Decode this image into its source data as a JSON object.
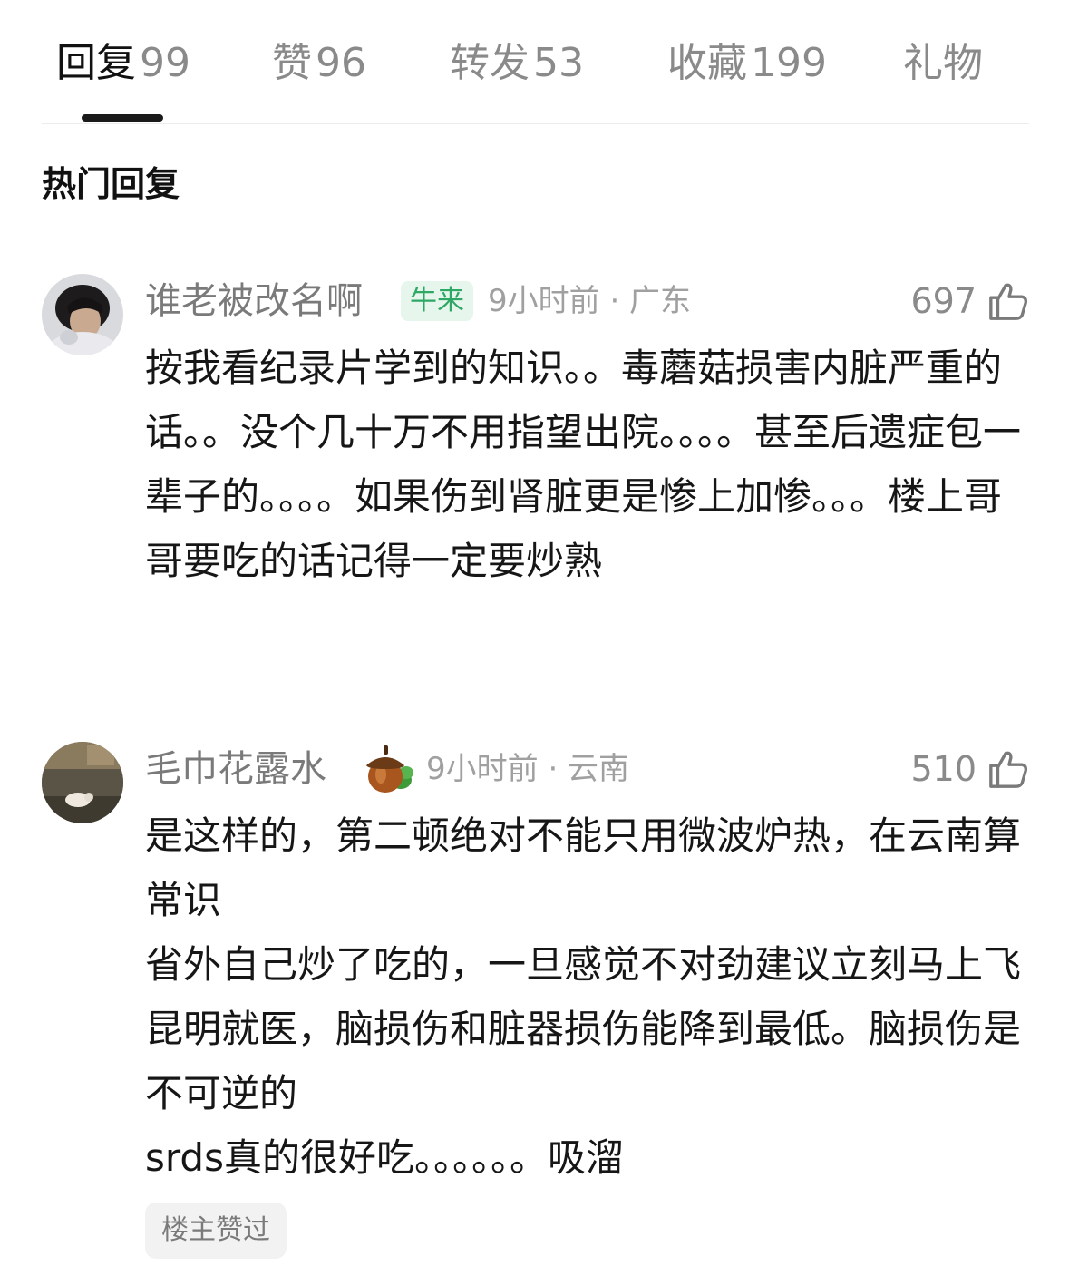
{
  "tabs": [
    {
      "label": "回复",
      "count": "99"
    },
    {
      "label": "赞",
      "count": "96"
    },
    {
      "label": "转发",
      "count": "53"
    },
    {
      "label": "收藏",
      "count": "199"
    },
    {
      "label": "礼物",
      "count": ""
    }
  ],
  "section_title": "热门回复",
  "comments": [
    {
      "username": "谁老被改名啊",
      "badge": "牛来",
      "meta": "9小时前 · 广东",
      "likes": "697",
      "text": "按我看纪录片学到的知识。。毒蘑菇损害内脏严重的话。。没个几十万不用指望出院。。。。甚至后遗症包一辈子的。。。。如果伤到肾脏更是惨上加惨。。。楼上哥哥要吃的话记得一定要炒熟"
    },
    {
      "username": "毛巾花露水",
      "badge_icon": "acorn-icon",
      "meta": "9小时前 · 云南",
      "likes": "510",
      "text": "是这样的，第二顿绝对不能只用微波炉热，在云南算常识\n省外自己炒了吃的，一旦感觉不对劲建议立刻马上飞昆明就医，脑损伤和脏器损伤能降到最低。脑损伤是不可逆的\nsrds真的很好吃。。。。。。吸溜",
      "op_tag": "楼主赞过"
    }
  ],
  "colors": {
    "active_tab": "#111111",
    "inactive_tab": "#8a8a8a",
    "badge_bg": "#e6f6ec",
    "badge_text": "#2fa866",
    "meta": "#a0a0a0"
  },
  "icons": {
    "like": "thumbs-up-icon",
    "badge": "acorn-icon"
  }
}
